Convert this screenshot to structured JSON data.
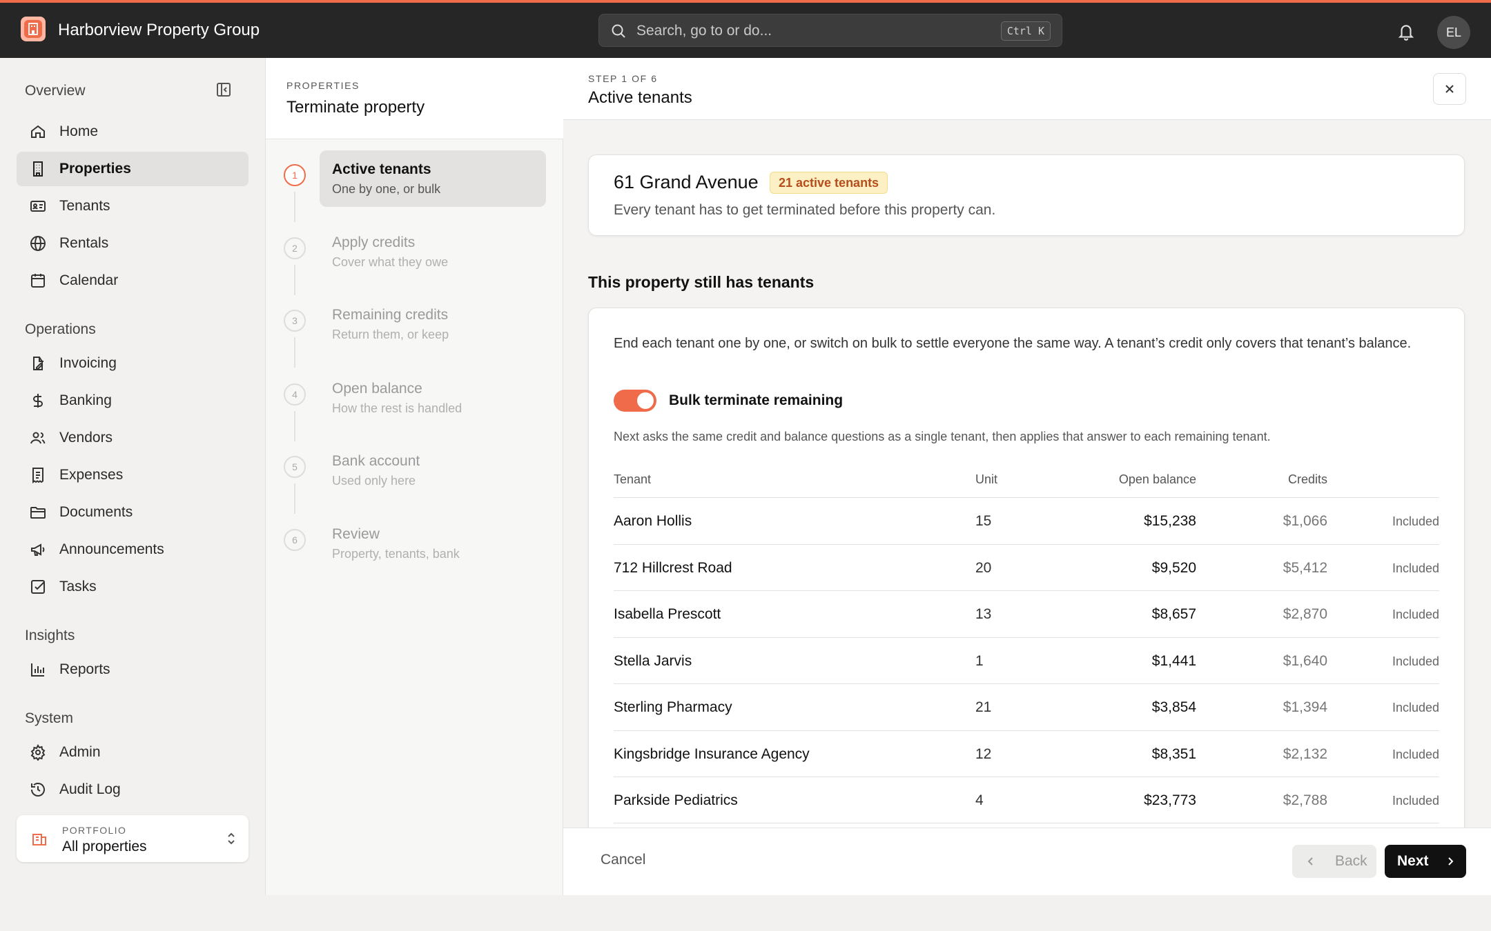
{
  "app": {
    "title": "Harborview Property Group",
    "accent": "#ef6b4a"
  },
  "search": {
    "placeholder": "Search, go to or do...",
    "shortcut": "Ctrl K"
  },
  "user": {
    "initials": "EL"
  },
  "sidebar": {
    "sections": [
      {
        "title": "Overview",
        "items": [
          {
            "label": "Home",
            "icon": "home-icon"
          },
          {
            "label": "Properties",
            "icon": "building-icon",
            "active": true
          },
          {
            "label": "Tenants",
            "icon": "id-card-icon"
          },
          {
            "label": "Rentals",
            "icon": "globe-icon"
          },
          {
            "label": "Calendar",
            "icon": "calendar-icon"
          }
        ]
      },
      {
        "title": "Operations",
        "items": [
          {
            "label": "Invoicing",
            "icon": "invoice-pen-icon"
          },
          {
            "label": "Banking",
            "icon": "dollar-icon"
          },
          {
            "label": "Vendors",
            "icon": "users-icon"
          },
          {
            "label": "Expenses",
            "icon": "receipt-icon"
          },
          {
            "label": "Documents",
            "icon": "folder-icon"
          },
          {
            "label": "Announcements",
            "icon": "megaphone-icon"
          },
          {
            "label": "Tasks",
            "icon": "checkbox-icon"
          }
        ]
      },
      {
        "title": "Insights",
        "items": [
          {
            "label": "Reports",
            "icon": "bar-chart-icon"
          }
        ]
      },
      {
        "title": "System",
        "items": [
          {
            "label": "Admin",
            "icon": "gear-icon"
          },
          {
            "label": "Audit Log",
            "icon": "history-icon"
          }
        ]
      }
    ],
    "portfolio": {
      "label": "PORTFOLIO",
      "value": "All properties"
    }
  },
  "wizard": {
    "eyebrow": "PROPERTIES",
    "title": "Terminate property",
    "steps": [
      {
        "num": "1",
        "title": "Active tenants",
        "desc": "One by one, or bulk",
        "current": true
      },
      {
        "num": "2",
        "title": "Apply credits",
        "desc": "Cover what they owe"
      },
      {
        "num": "3",
        "title": "Remaining credits",
        "desc": "Return them, or keep"
      },
      {
        "num": "4",
        "title": "Open balance",
        "desc": "How the rest is handled"
      },
      {
        "num": "5",
        "title": "Bank account",
        "desc": "Used only here"
      },
      {
        "num": "6",
        "title": "Review",
        "desc": "Property, tenants, bank"
      }
    ]
  },
  "main": {
    "step_label": "STEP 1 OF 6",
    "title": "Active tenants",
    "property": {
      "name": "61 Grand Avenue",
      "badge": "21 active tenants",
      "description": "Every tenant has to get terminated before this property can."
    },
    "section_title": "This property still has tenants",
    "intro": "End each tenant one by one, or switch on bulk to settle everyone the same way. A tenant’s credit only covers that tenant’s balance.",
    "bulk_toggle": {
      "label": "Bulk terminate remaining",
      "on": true
    },
    "hint": "Next asks the same credit and balance questions as a single tenant, then applies that answer to each remaining tenant.",
    "table": {
      "headers": {
        "tenant": "Tenant",
        "unit": "Unit",
        "balance": "Open balance",
        "credits": "Credits"
      },
      "rows": [
        {
          "tenant": "Aaron Hollis",
          "unit": "15",
          "balance": "$15,238",
          "credits": "$1,066",
          "status": "Included"
        },
        {
          "tenant": "712 Hillcrest Road",
          "unit": "20",
          "balance": "$9,520",
          "credits": "$5,412",
          "status": "Included"
        },
        {
          "tenant": "Isabella Prescott",
          "unit": "13",
          "balance": "$8,657",
          "credits": "$2,870",
          "status": "Included"
        },
        {
          "tenant": "Stella Jarvis",
          "unit": "1",
          "balance": "$1,441",
          "credits": "$1,640",
          "status": "Included"
        },
        {
          "tenant": "Sterling Pharmacy",
          "unit": "21",
          "balance": "$3,854",
          "credits": "$1,394",
          "status": "Included"
        },
        {
          "tenant": "Kingsbridge Insurance Agency",
          "unit": "12",
          "balance": "$8,351",
          "credits": "$2,132",
          "status": "Included"
        },
        {
          "tenant": "Parkside Pediatrics",
          "unit": "4",
          "balance": "$23,773",
          "credits": "$2,788",
          "status": "Included"
        }
      ]
    },
    "footer": {
      "cancel": "Cancel",
      "back": "Back",
      "next": "Next"
    }
  }
}
